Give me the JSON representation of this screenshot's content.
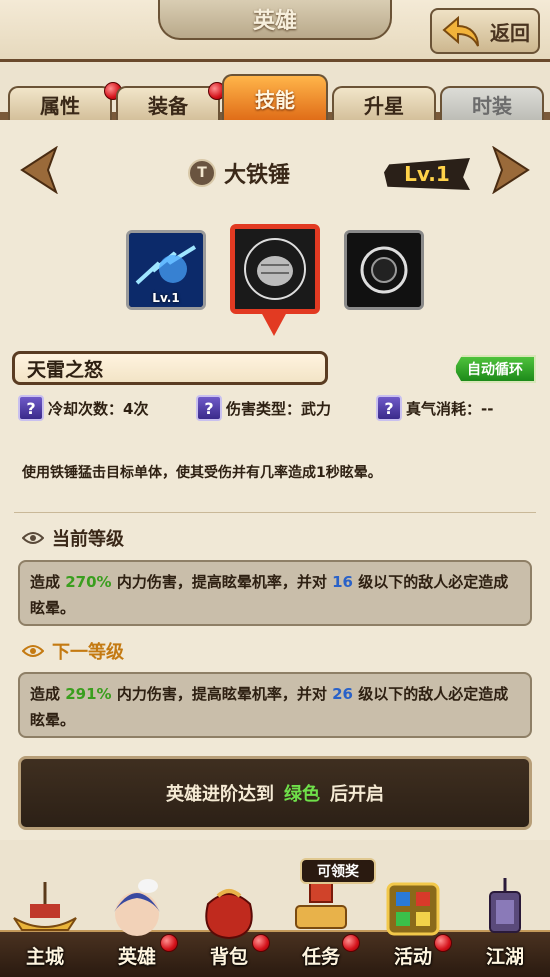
{
  "header": {
    "title": "英雄",
    "back_label": "返回"
  },
  "tabs": [
    {
      "label": "属性",
      "badge": true
    },
    {
      "label": "装备",
      "badge": true
    },
    {
      "label": "技能",
      "active": true
    },
    {
      "label": "升星"
    },
    {
      "label": "时装",
      "disabled": true
    }
  ],
  "skill": {
    "type_badge": "T",
    "name": "大铁锤",
    "level": "Lv.1",
    "icons": [
      {
        "name": "thunder-skill-icon",
        "level": "Lv.1"
      },
      {
        "name": "fist-skill-icon"
      },
      {
        "name": "shockwave-skill-icon"
      }
    ],
    "title": "天雷之怒",
    "auto_tag": "自动循环",
    "stats": {
      "cooldown": "冷却次数：4次",
      "damage_type": "伤害类型：武力",
      "energy_cost": "真气消耗：--"
    },
    "description": "使用铁锤猛击目标单体，使其受伤并有几率造成1秒眩晕。"
  },
  "current_level": {
    "heading": "当前等级",
    "text_before": "造成",
    "percent": "270%",
    "text_mid": "内力伤害，提高眩晕机率，并对",
    "level_limit": "16",
    "text_after": "级以下的敌人必定造成眩晕。"
  },
  "next_level": {
    "heading": "下一等级",
    "text_before": "造成",
    "percent": "291%",
    "text_mid": "内力伤害，提高眩晕机率，并对",
    "level_limit": "26",
    "text_after": "级以下的敌人必定造成眩晕。"
  },
  "unlock": {
    "before": "英雄进阶达到",
    "color_word": "绿色",
    "after": "后开启"
  },
  "bottom_nav": {
    "items": [
      {
        "label": "主城"
      },
      {
        "label": "英雄",
        "badge": true
      },
      {
        "label": "背包",
        "badge": true
      },
      {
        "label": "任务",
        "badge": true
      },
      {
        "label": "活动",
        "badge": true
      },
      {
        "label": "江湖"
      }
    ],
    "claim_tag": "可领奖"
  },
  "colors": {
    "accent": "#e06d18",
    "highlight_green": "#3a9e1e",
    "highlight_blue": "#2a62c8",
    "badge_red": "#d4121a"
  }
}
